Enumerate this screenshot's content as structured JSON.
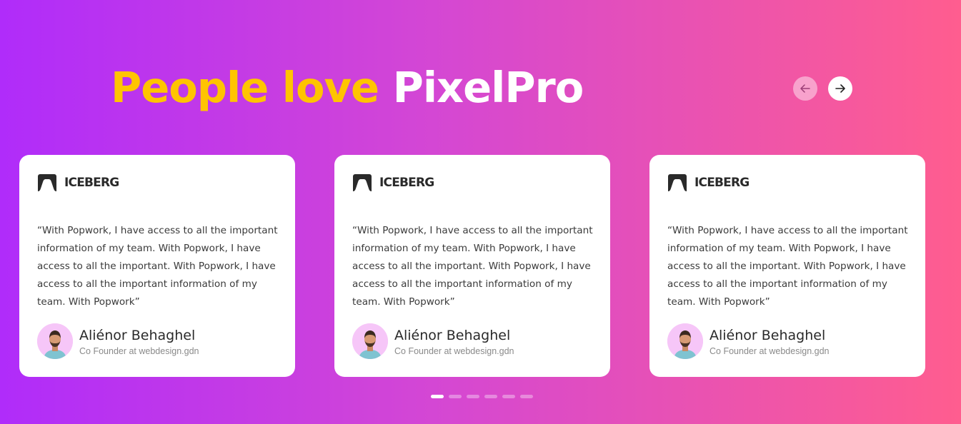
{
  "header": {
    "title_accent": "People love",
    "title_brand": "PixelPro"
  },
  "nav": {
    "prev_icon": "arrow-left-icon",
    "next_icon": "arrow-right-icon"
  },
  "colors": {
    "accent": "#ffc400",
    "gradient_start": "#b02cfa",
    "gradient_end": "#ff5d8f"
  },
  "testimonials": [
    {
      "company": "ICEBERG",
      "quote": "“With Popwork, I have access to all the important information of my team. With Popwork, I have access to all the important. With Popwork, I have access to all the important information of my team. With Popwork”",
      "name": "Aliénor Behaghel",
      "role": "Co Founder at webdesign.gdn"
    },
    {
      "company": "ICEBERG",
      "quote": "“With Popwork, I have access to all the important information of my team. With Popwork, I have access to all the important. With Popwork, I have access to all the important information of my team. With Popwork”",
      "name": "Aliénor Behaghel",
      "role": "Co Founder at webdesign.gdn"
    },
    {
      "company": "ICEBERG",
      "quote": "“With Popwork, I have access to all the important information of my team. With Popwork, I have access to all the important. With Popwork, I have access to all the important information of my team. With Popwork”",
      "name": "Aliénor Behaghel",
      "role": "Co Founder at webdesign.gdn"
    }
  ],
  "pagination": {
    "total": 6,
    "active": 1
  }
}
